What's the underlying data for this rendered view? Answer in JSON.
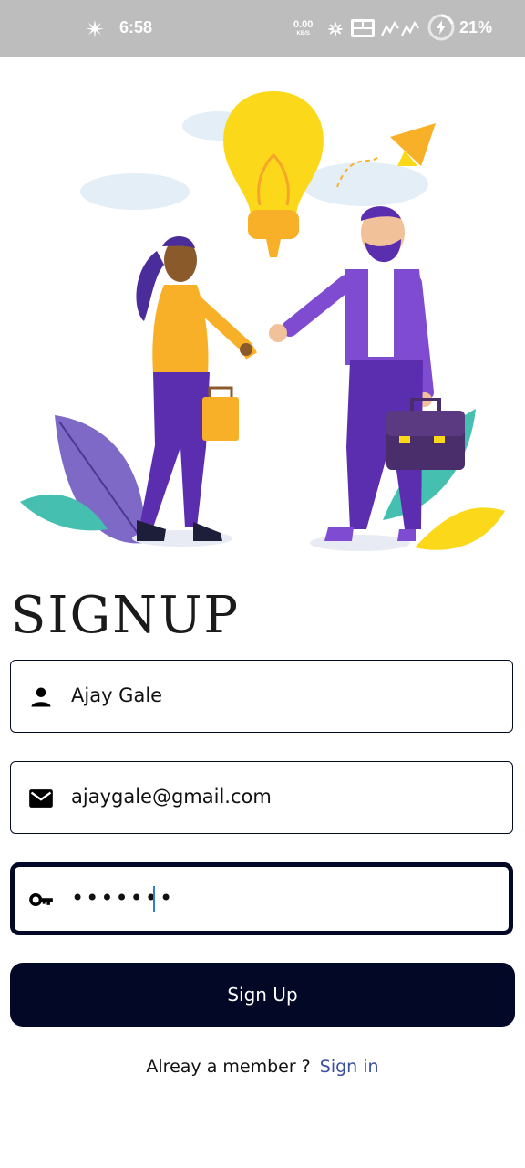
{
  "status_bar": {
    "time": "6:58",
    "net_speed_value": "0.00",
    "net_speed_unit": "KB/S",
    "battery": "21%"
  },
  "title": "SIGNUP",
  "name_field": {
    "value": "Ajay Gale",
    "icon": "person-icon"
  },
  "email_field": {
    "value": "ajaygale@gmail.com",
    "icon": "mail-icon"
  },
  "password_field": {
    "value": "•••••••",
    "icon": "key-icon"
  },
  "signup_button": "Sign Up",
  "footer": {
    "prompt": "Alreay a member ?",
    "link": "Sign in"
  },
  "colors": {
    "primary": "#030826",
    "link": "#3b4fa0",
    "status_bar": "#bdbdbd",
    "caret": "#2c7fd6"
  }
}
